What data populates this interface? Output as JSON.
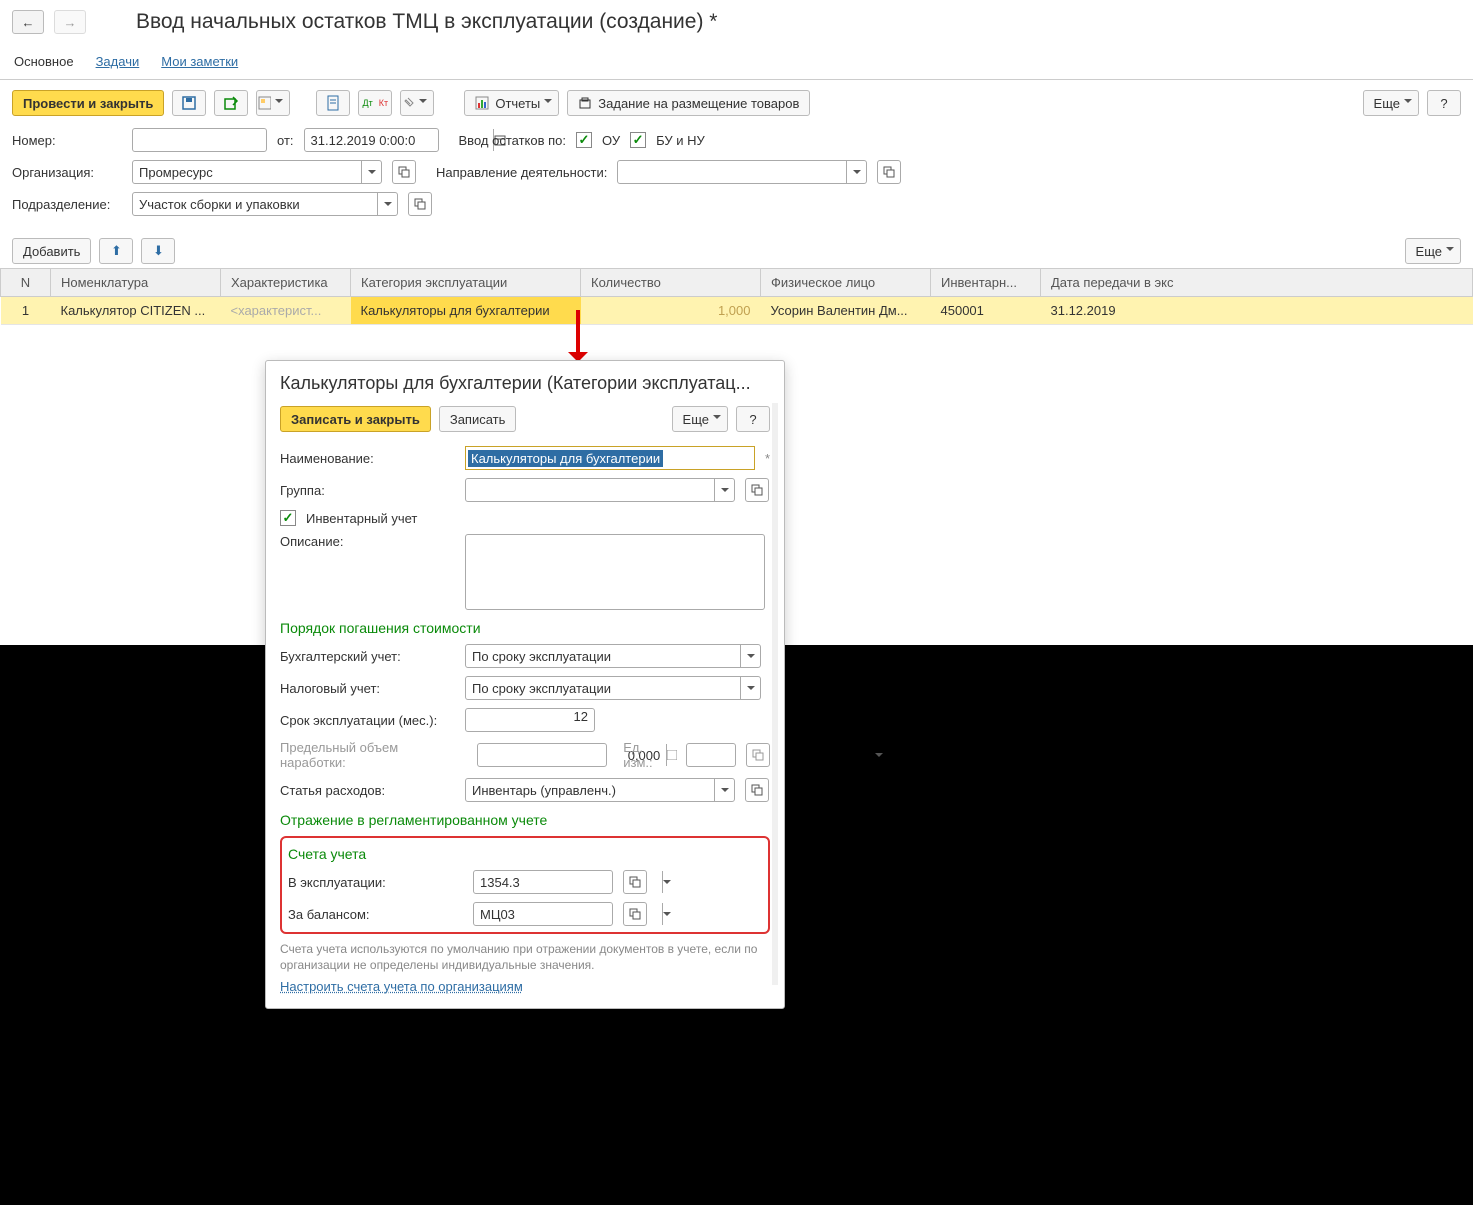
{
  "title": "Ввод начальных остатков ТМЦ в эксплуатации (создание) *",
  "tabs": {
    "main": "Основное",
    "tasks": "Задачи",
    "notes": "Мои заметки"
  },
  "toolbar": {
    "post_close": "Провести и закрыть",
    "reports": "Отчеты",
    "placement": "Задание на размещение товаров",
    "more": "Еще"
  },
  "form": {
    "number_label": "Номер:",
    "number": "",
    "from": "от:",
    "date": "31.12.2019 0:00:0",
    "balances_label": "Ввод остатков по:",
    "ou": "ОУ",
    "bunu": "БУ и НУ",
    "org_label": "Организация:",
    "org": "Промресурс",
    "dir_label": "Направление деятельности:",
    "dir": "",
    "dept_label": "Подразделение:",
    "dept": "Участок сборки и упаковки",
    "add": "Добавить"
  },
  "table": {
    "cols": [
      "N",
      "Номенклатура",
      "Характеристика",
      "Категория эксплуатации",
      "Количество",
      "Физическое лицо",
      "Инвентарн...",
      "Дата передачи в экс"
    ],
    "row": {
      "n": "1",
      "nom": "Калькулятор CITIZEN ...",
      "char": "<характерист...",
      "cat": "Калькуляторы для бухгалтерии",
      "qty": "1,000",
      "person": "Усорин Валентин Дм...",
      "inv": "450001",
      "date": "31.12.2019"
    }
  },
  "popup": {
    "title": "Калькуляторы для бухгалтерии (Категории эксплуатац...",
    "save_close": "Записать и закрыть",
    "save": "Записать",
    "more": "Еще",
    "name_label": "Наименование:",
    "name": "Калькуляторы для бухгалтерии",
    "group_label": "Группа:",
    "group": "",
    "inv_check": "Инвентарный учет",
    "desc_label": "Описание:",
    "sec1": "Порядок погашения стоимости",
    "acc_label": "Бухгалтерский учет:",
    "acc": "По сроку эксплуатации",
    "tax_label": "Налоговый учет:",
    "tax": "По сроку эксплуатации",
    "term_label": "Срок эксплуатации (мес.):",
    "term": "12",
    "maxvol_label": "Предельный объем наработки:",
    "maxvol": "0,000",
    "unit_label": "Ед. изм.:",
    "unit": "",
    "article_label": "Статья расходов:",
    "article": "Инвентарь (управленч.)",
    "sec2": "Отражение в регламентированном учете",
    "sec3": "Счета учета",
    "inuse_label": "В эксплуатации:",
    "inuse": "1354.3",
    "offbal_label": "За балансом:",
    "offbal": "МЦ03",
    "hint": "Счета учета используются по умолчанию при отражении документов в учете, если по организации не определены индивидуальные значения.",
    "link": "Настроить счета учета по организациям"
  }
}
